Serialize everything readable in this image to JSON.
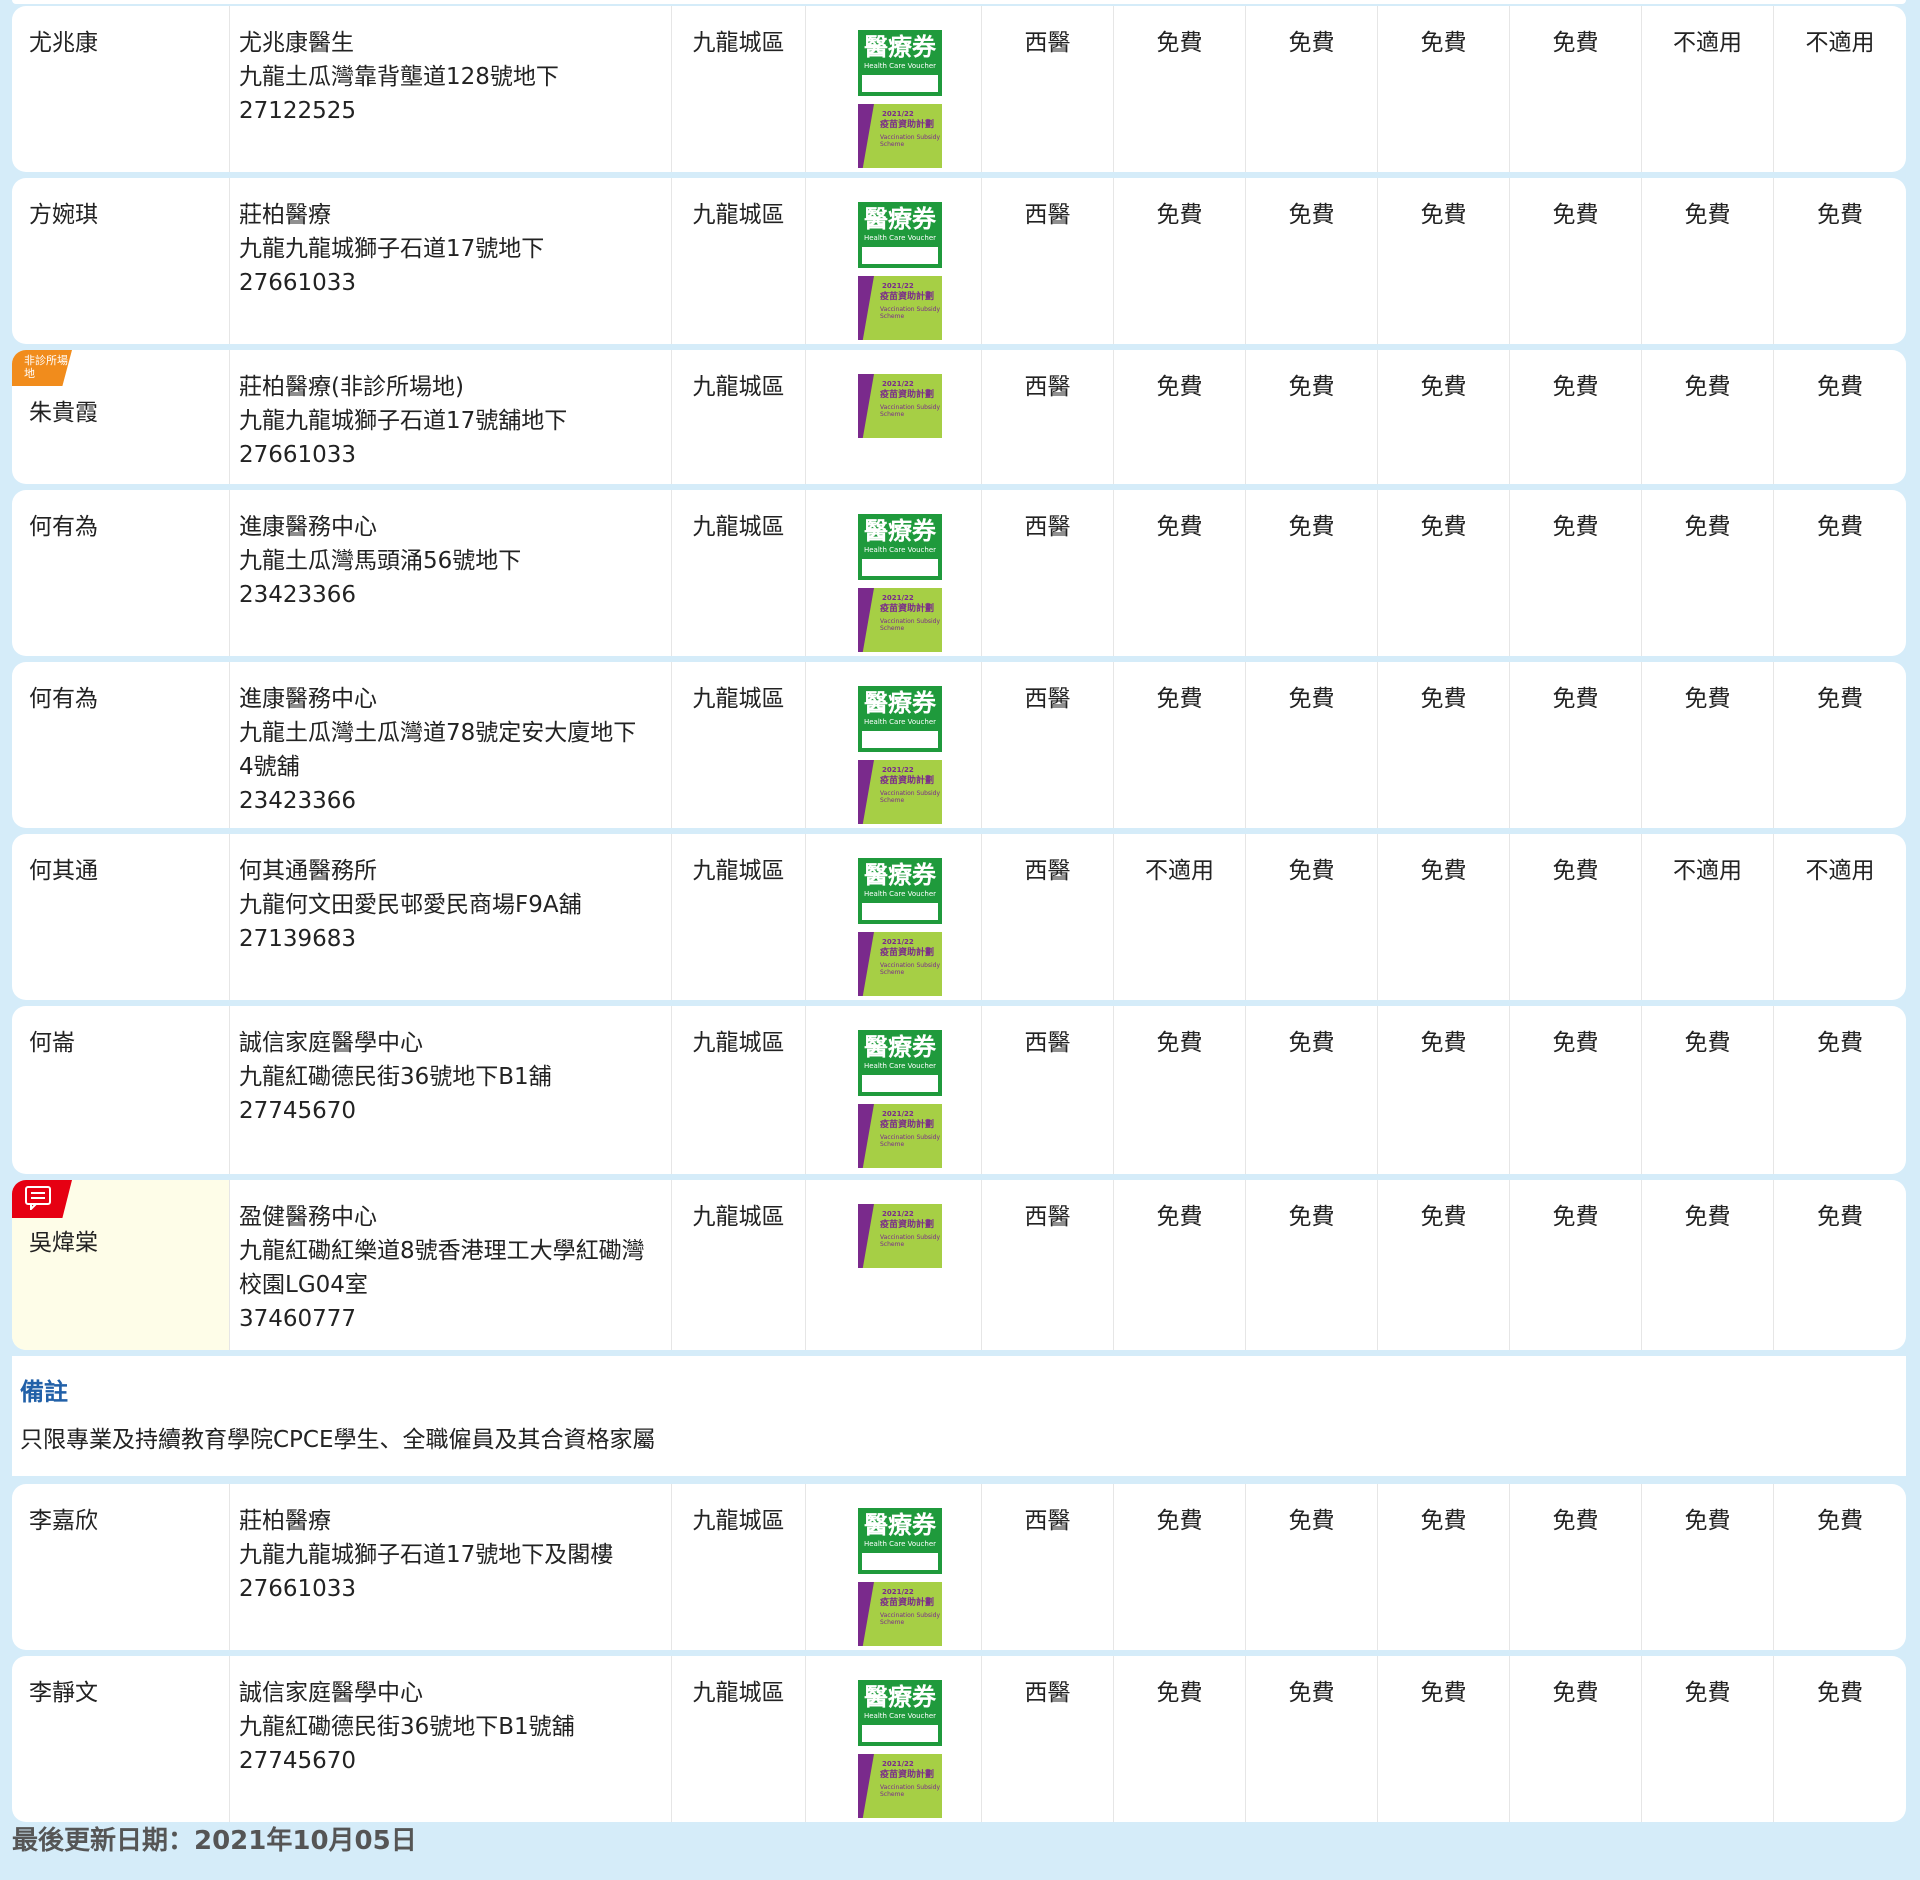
{
  "icon_labels": {
    "hcv_title": "醫療券",
    "hcv_sub": "Health Care Voucher",
    "vss_year": "2021/22",
    "vss_title": "疫苗資助計劃",
    "vss_sub": "Vaccination Subsidy Scheme"
  },
  "tags": {
    "non_clinic": "非診所場地"
  },
  "colors": {
    "page_bg": "#d5ecf9",
    "remark_title": "#2160a8",
    "tag_orange": "#f18c1c",
    "tag_red": "#e60012",
    "hcv_green": "#1f9a3c",
    "vss_green": "#a6cf45",
    "vss_purple": "#7a2a8c",
    "highlight": "#fefde8"
  },
  "rows": [
    {
      "name": "尤兆康",
      "clinic": [
        "尤兆康醫生",
        "九龍土瓜灣靠背壟道128號地下",
        "27122525"
      ],
      "district": "九龍城區",
      "hcv": true,
      "vss": true,
      "tag": "",
      "type": "西醫",
      "values": [
        "免費",
        "免費",
        "免費",
        "免費",
        "不適用",
        "不適用"
      ]
    },
    {
      "name": "方婉琪",
      "clinic": [
        "莊柏醫療",
        "九龍九龍城獅子石道17號地下",
        "27661033"
      ],
      "district": "九龍城區",
      "hcv": true,
      "vss": true,
      "tag": "",
      "type": "西醫",
      "values": [
        "免費",
        "免費",
        "免費",
        "免費",
        "免費",
        "免費"
      ]
    },
    {
      "name": "朱貴霞",
      "clinic": [
        "莊柏醫療(非診所場地)",
        "九龍九龍城獅子石道17號舖地下",
        "27661033"
      ],
      "district": "九龍城區",
      "hcv": false,
      "vss": true,
      "tag": "orange",
      "type": "西醫",
      "values": [
        "免費",
        "免費",
        "免費",
        "免費",
        "免費",
        "免費"
      ]
    },
    {
      "name": "何有為",
      "clinic": [
        "進康醫務中心",
        "九龍土瓜灣馬頭涌56號地下",
        "23423366"
      ],
      "district": "九龍城區",
      "hcv": true,
      "vss": true,
      "tag": "",
      "type": "西醫",
      "values": [
        "免費",
        "免費",
        "免費",
        "免費",
        "免費",
        "免費"
      ]
    },
    {
      "name": "何有為",
      "clinic": [
        "進康醫務中心",
        "九龍土瓜灣土瓜灣道78號定安大廈地下",
        "4號舖",
        "23423366"
      ],
      "district": "九龍城區",
      "hcv": true,
      "vss": true,
      "tag": "",
      "type": "西醫",
      "values": [
        "免費",
        "免費",
        "免費",
        "免費",
        "免費",
        "免費"
      ]
    },
    {
      "name": "何其通",
      "clinic": [
        "何其通醫務所",
        "九龍何文田愛民邨愛民商場F9A舖",
        "27139683"
      ],
      "district": "九龍城區",
      "hcv": true,
      "vss": true,
      "tag": "",
      "type": "西醫",
      "values": [
        "不適用",
        "免費",
        "免費",
        "免費",
        "不適用",
        "不適用"
      ]
    },
    {
      "name": "何崙",
      "clinic": [
        "誠信家庭醫學中心",
        "九龍紅磡德民街36號地下B1舖",
        "27745670"
      ],
      "district": "九龍城區",
      "hcv": true,
      "vss": true,
      "tag": "",
      "type": "西醫",
      "values": [
        "免費",
        "免費",
        "免費",
        "免費",
        "免費",
        "免費"
      ]
    },
    {
      "name": "吳煒棠",
      "clinic": [
        "盈健醫務中心",
        "九龍紅磡紅樂道8號香港理工大學紅磡灣",
        "校園LG04室",
        "37460777"
      ],
      "district": "九龍城區",
      "hcv": false,
      "vss": true,
      "tag": "red",
      "type": "西醫",
      "values": [
        "免費",
        "免費",
        "免費",
        "免費",
        "免費",
        "免費"
      ]
    },
    {
      "name": "李嘉欣",
      "clinic": [
        "莊柏醫療",
        "九龍九龍城獅子石道17號地下及閣樓",
        "27661033"
      ],
      "district": "九龍城區",
      "hcv": true,
      "vss": true,
      "tag": "",
      "type": "西醫",
      "values": [
        "免費",
        "免費",
        "免費",
        "免費",
        "免費",
        "免費"
      ]
    },
    {
      "name": "李靜文",
      "clinic": [
        "誠信家庭醫學中心",
        "九龍紅磡德民街36號地下B1號舖",
        "27745670"
      ],
      "district": "九龍城區",
      "hcv": true,
      "vss": true,
      "tag": "",
      "type": "西醫",
      "values": [
        "免費",
        "免費",
        "免費",
        "免費",
        "免費",
        "免費"
      ]
    }
  ],
  "remark": {
    "title": "備註",
    "text": "只限專業及持續教育學院CPCE學生、全職僱員及其合資格家屬"
  },
  "last_updated": "最後更新日期：2021年10月05日"
}
